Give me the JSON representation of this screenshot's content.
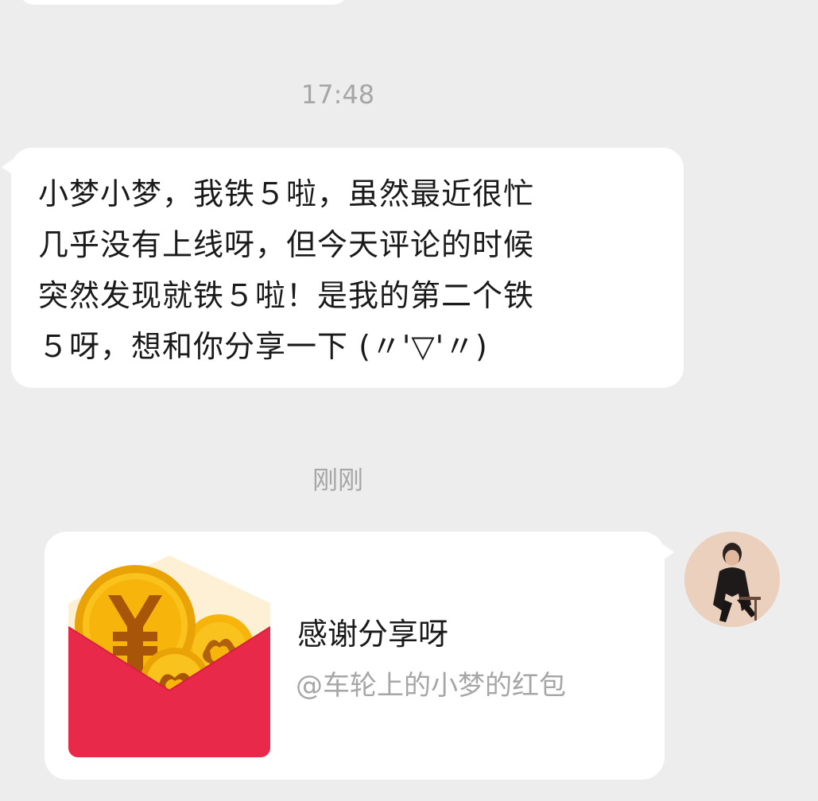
{
  "timestamps": {
    "first": "17:48",
    "second": "刚刚"
  },
  "incoming_message": {
    "lines": [
      "小梦小梦，我铁５啦，虽然最近很忙",
      "几乎没有上线呀，但今天评论的时候",
      "突然发现就铁５啦！是我的第二个铁",
      "５呀，想和你分享一下 (〃'▽'〃)"
    ]
  },
  "red_packet": {
    "title": "感谢分享呀",
    "subtitle": "@车轮上的小梦的红包",
    "icon": "red-packet-coin-icon",
    "colors": {
      "envelope": "#e8294a",
      "coin": "#f7b50c",
      "coin_mark": "#a8550a"
    }
  },
  "avatar": {
    "icon": "user-avatar"
  },
  "colors": {
    "background": "#ededed",
    "bubble": "#ffffff",
    "timestamp": "#a6a6a6",
    "text": "#1a1a1a"
  }
}
